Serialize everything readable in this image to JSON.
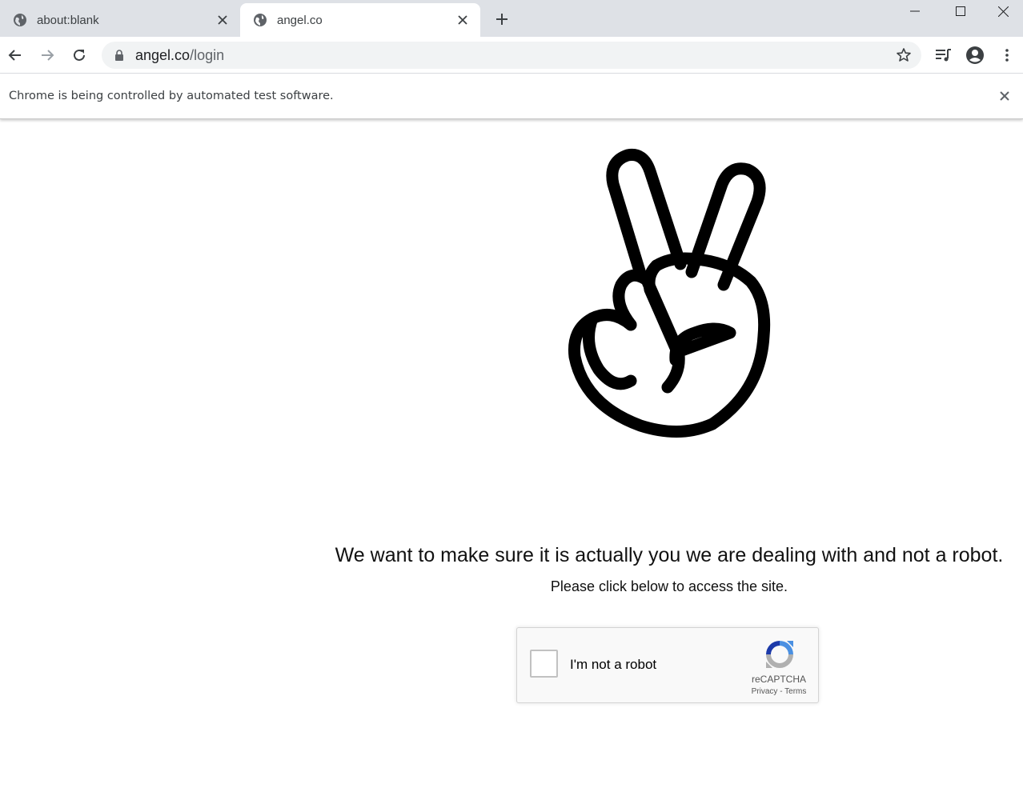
{
  "browser": {
    "tabs": [
      {
        "title": "about:blank",
        "icon": "globe-icon",
        "active": false
      },
      {
        "title": "angel.co",
        "icon": "globe-icon",
        "active": true
      }
    ],
    "omnibox": {
      "host": "angel.co",
      "path": "/login"
    },
    "infobar": {
      "message": "Chrome is being controlled by automated test software."
    }
  },
  "page": {
    "logo": "peace-hand-icon",
    "headline": "We want to make sure it is actually you we are dealing with and not a robot.",
    "subline": "Please click below to access the site.",
    "recaptcha": {
      "checkbox_label": "I'm not a robot",
      "brand": "reCAPTCHA",
      "privacy": "Privacy",
      "separator": " - ",
      "terms": "Terms"
    }
  },
  "colors": {
    "tabstrip": "#dee1e6",
    "omnibox": "#f1f3f4",
    "recaptcha_blue": "#4a90e2",
    "recaptcha_gray": "#b0b0b0"
  }
}
